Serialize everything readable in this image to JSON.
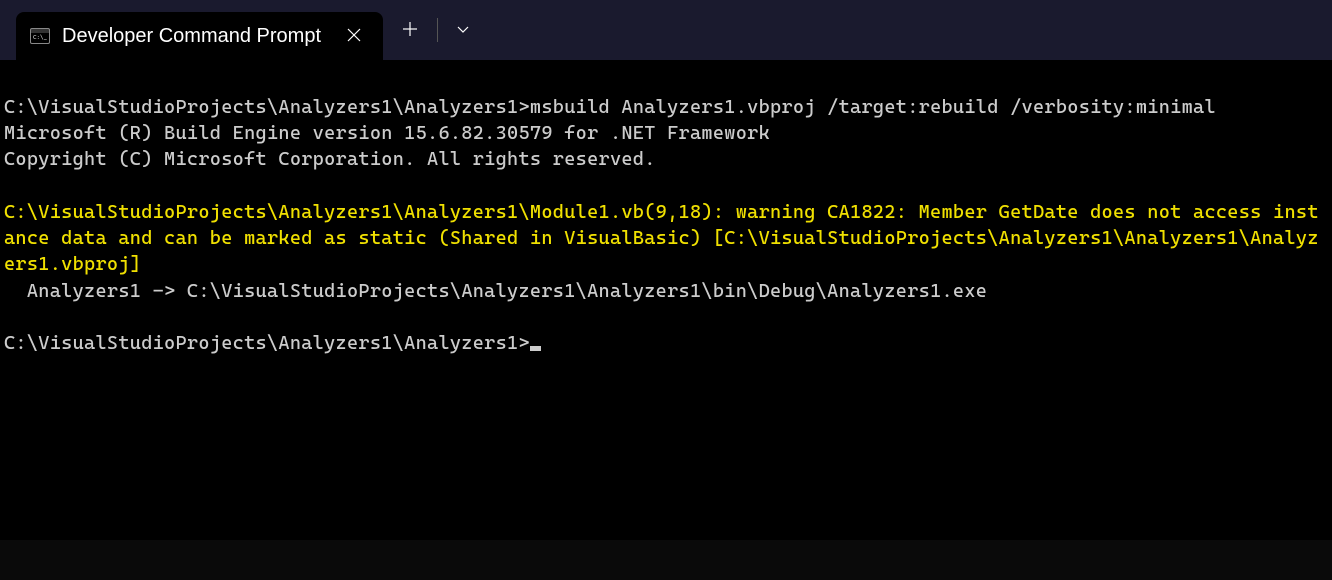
{
  "tab": {
    "title": "Developer Command Prompt"
  },
  "terminal": {
    "prompt1_path": "C:\\VisualStudioProjects\\Analyzers1\\Analyzers1>",
    "command": "msbuild Analyzers1.vbproj /target:rebuild /verbosity:minimal",
    "engine_line": "Microsoft (R) Build Engine version 15.6.82.30579 for .NET Framework",
    "copyright_line": "Copyright (C) Microsoft Corporation. All rights reserved.",
    "warning_text": "C:\\VisualStudioProjects\\Analyzers1\\Analyzers1\\Module1.vb(9,18): warning CA1822: Member GetDate does not access instance data and can be marked as static (Shared in VisualBasic) [C:\\VisualStudioProjects\\Analyzers1\\Analyzers1\\Analyzers1.vbproj]",
    "output_line": "  Analyzers1 -> C:\\VisualStudioProjects\\Analyzers1\\Analyzers1\\bin\\Debug\\Analyzers1.exe",
    "prompt2_path": "C:\\VisualStudioProjects\\Analyzers1\\Analyzers1>"
  }
}
